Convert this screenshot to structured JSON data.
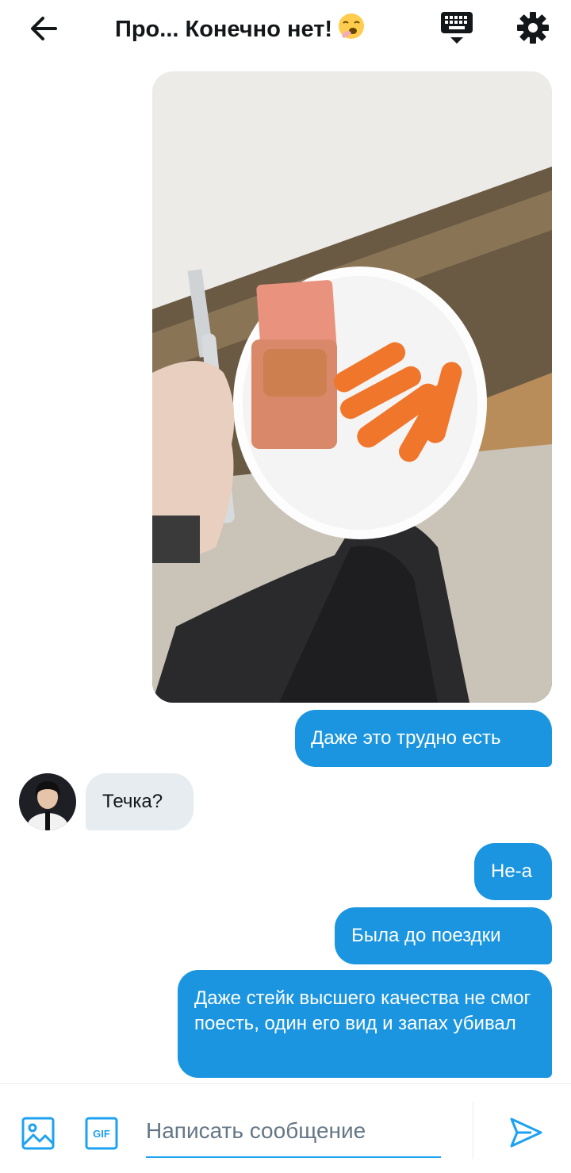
{
  "header": {
    "title": "Про... Конечно нет!",
    "title_emoji": "yawning-face-emoji",
    "icons": [
      "back-arrow-icon",
      "keyboard-icon",
      "gear-icon"
    ]
  },
  "messages": [
    {
      "side": "outgoing",
      "type": "image",
      "description_icon": "photo"
    },
    {
      "side": "outgoing",
      "text": "Даже это трудно есть"
    },
    {
      "side": "incoming",
      "text": "Течка?"
    },
    {
      "side": "outgoing",
      "text": "Не-а"
    },
    {
      "side": "outgoing",
      "text": "Была до поездки"
    },
    {
      "side": "outgoing",
      "text": "Даже стейк высшего качества не смог поесть, один его вид и запах убивал"
    }
  ],
  "composer": {
    "placeholder": "Написать сообщение",
    "value": "",
    "gif_label": "GIF",
    "icons": [
      "image-icon",
      "gif-icon",
      "send-icon"
    ]
  },
  "colors": {
    "accent": "#1da1f2",
    "outgoing_bubble": "#1b95e0",
    "incoming_bubble": "#e6ecf0",
    "text_primary": "#14171a",
    "placeholder": "#657786"
  }
}
